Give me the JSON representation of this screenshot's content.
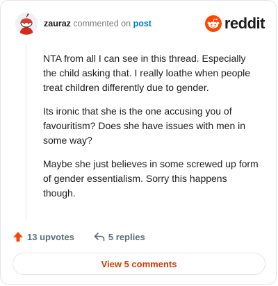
{
  "header": {
    "username": "zauraz",
    "action_text": "commented on",
    "post_link": "post",
    "brand": "reddit"
  },
  "comment": {
    "paragraphs": [
      "NTA from all I can see in this thread. Especially the child asking that. I really loathe when people treat children differently due to gender.",
      "Its ironic that she is the one accusing you of favouritism? Does she have issues with men in some way?",
      "Maybe she just believes in some screwed up form of gender essentialism. Sorry this happens though."
    ]
  },
  "footer": {
    "upvotes": "13 upvotes",
    "replies": "5 replies",
    "view_comments": "View 5 comments"
  },
  "colors": {
    "accent": "#FF4500",
    "link": "#0079D3",
    "view_button_text": "#D93A00"
  }
}
